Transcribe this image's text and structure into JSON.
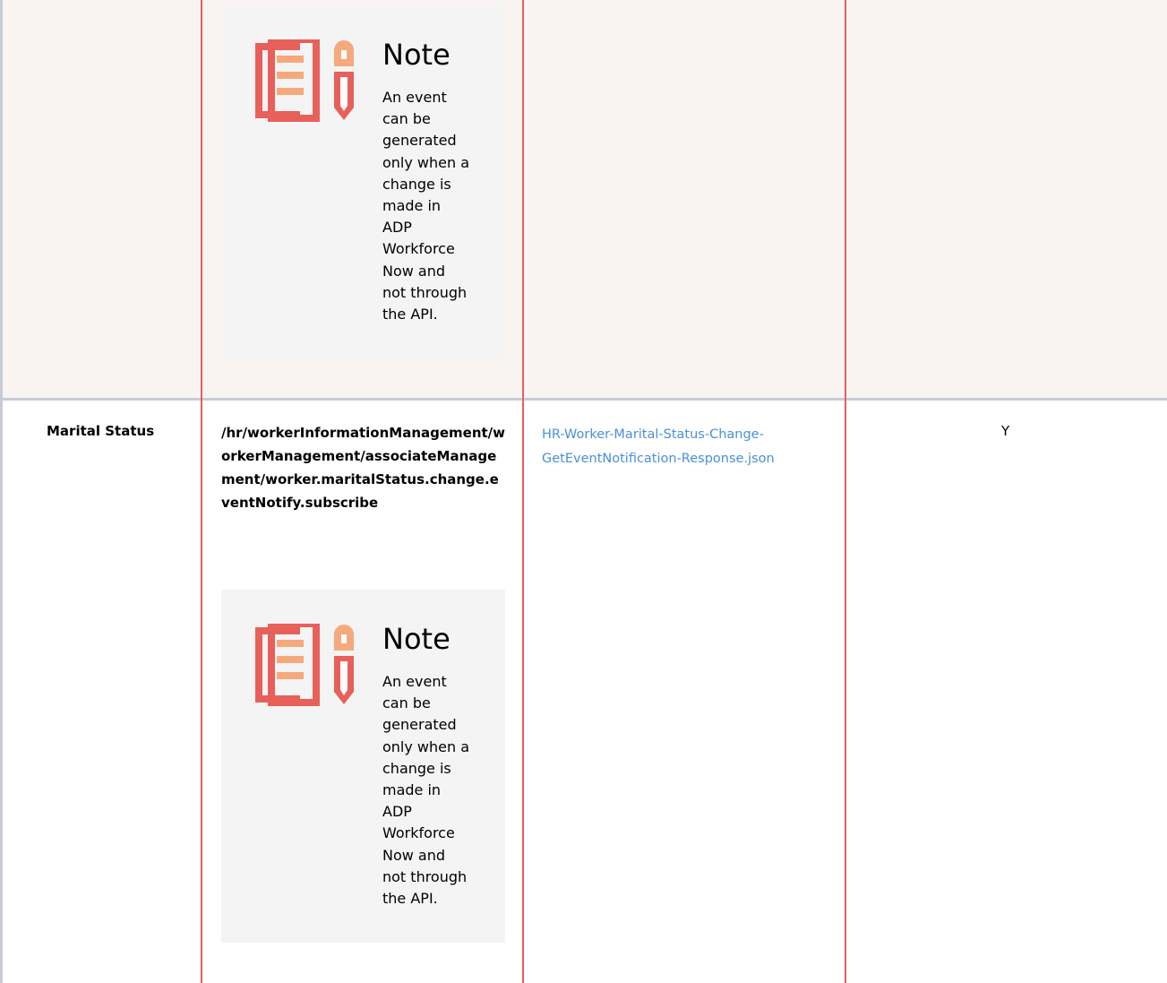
{
  "notes": [
    {
      "title": "Note",
      "lines": [
        "An event",
        "can be",
        "generated",
        "only when a",
        "change is",
        "made in",
        "ADP",
        "Workforce",
        "Now and",
        "not through",
        "the API."
      ]
    },
    {
      "title": "Note",
      "lines": [
        "An event",
        "can be",
        "generated",
        "only when a",
        "change is",
        "made in",
        "ADP",
        "Workforce",
        "Now and",
        "not through",
        "the API."
      ]
    }
  ],
  "row": {
    "label": "Marital Status",
    "path": "/hr/workerInformationManagement/workerManagement/associateManagement/worker.maritalStatus.change.eventNotify.subscribe",
    "link_line1": "HR-Worker-Marital-Status-Change-",
    "link_line2": "GetEventNotification-Response.json",
    "flag": "Y"
  },
  "icon": "note-document-pencil-icon",
  "colors": {
    "accent_red": "#e8605a",
    "accent_peach": "#f6a97c",
    "row_bg": "#f9f4f1",
    "note_bg": "#f4f4f4",
    "divider": "#c7cbd3",
    "link": "#4a90d9"
  }
}
